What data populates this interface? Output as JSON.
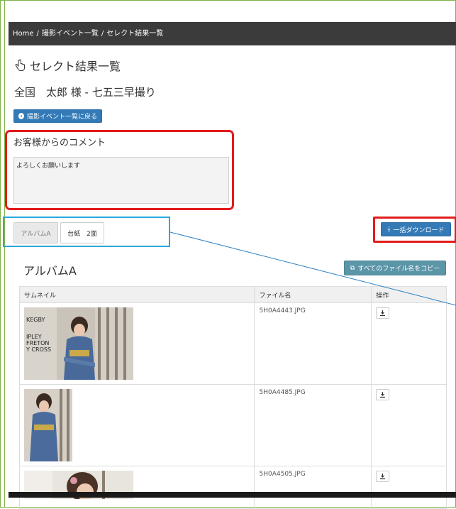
{
  "breadcrumb": {
    "items": [
      "Home",
      "撮影イベント一覧",
      "セレクト結果一覧"
    ],
    "separator": "/"
  },
  "page": {
    "title": "セレクト結果一覧",
    "customer_line": "全国　太郎 様 - 七五三早撮り",
    "back_button_label": "撮影イベント一覧に戻る"
  },
  "comment": {
    "heading": "お客様からのコメント",
    "text": "よろしくお願いします"
  },
  "tabs": [
    {
      "label": "アルバムA",
      "active": true
    },
    {
      "label": "台紙　2面",
      "active": false
    }
  ],
  "bulk_download_label": "一括ダウンロード",
  "album": {
    "title": "アルバムA",
    "copy_button_label": "すべてのファイル名をコピー",
    "columns": [
      "サムネイル",
      "ファイル名",
      "操作"
    ],
    "rows": [
      {
        "filename": "5H0A4443.JPG"
      },
      {
        "filename": "5H0A4485.JPG"
      },
      {
        "filename": "5H0A4505.JPG"
      }
    ]
  },
  "thumbnail_texts": [
    "KEGBY",
    "IPLEY",
    "FRETON",
    "Y CROSS"
  ],
  "colors": {
    "primary_button": "#337ab7",
    "copy_button": "#5b95a8",
    "highlight_red": "#e31b1b",
    "highlight_blue": "#29a8e0",
    "frame_green": "#7fb24a"
  }
}
